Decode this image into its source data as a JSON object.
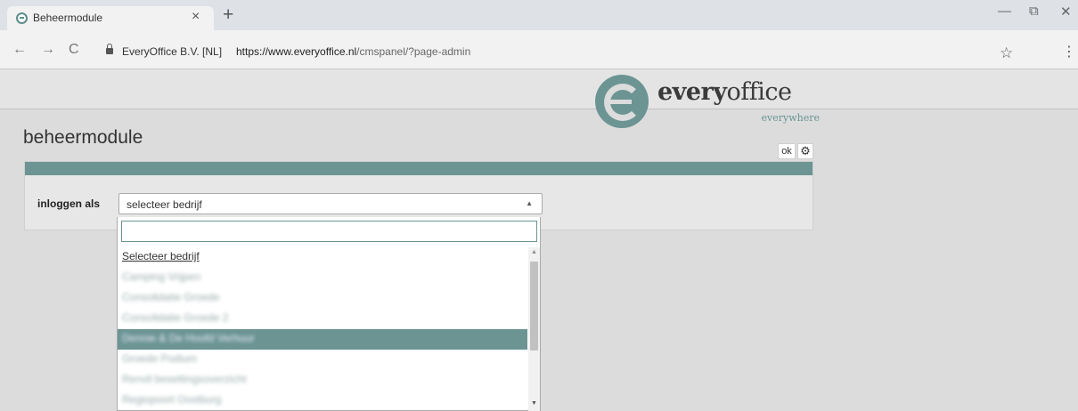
{
  "browser": {
    "tab_title": "Beheermodule",
    "tab_close": "×",
    "new_tab": "+",
    "win_minimize": "—",
    "win_restore": "⧉",
    "win_close": "✕",
    "back": "←",
    "forward": "→",
    "reload": "C",
    "site_identity": "EveryOffice B.V. [NL]",
    "url_host": "https://www.everyoffice.nl",
    "url_path": "/cmspanel/?page-admin",
    "star": "☆",
    "menu": "⋮"
  },
  "logo": {
    "word_bold": "every",
    "word_light": "office",
    "tagline": "everywhere",
    "color": "#6b9493"
  },
  "page": {
    "title": "beheermodule",
    "ok_label": "ok",
    "gear": "⚙"
  },
  "login": {
    "label": "inloggen als",
    "selected_value": "selecteer bedrijf"
  },
  "dropdown": {
    "search_value": "",
    "items": [
      "Selecteer bedrijf",
      "Camping Vrijpen",
      "Consolidatie Groede",
      "Consolidatie Groede 2",
      "Dennie & De Hoofd Verhuur",
      "Groede Podium",
      "Renvil besettingsoverzicht",
      "Regiopoort Oostburg"
    ],
    "selected_index": 4
  }
}
